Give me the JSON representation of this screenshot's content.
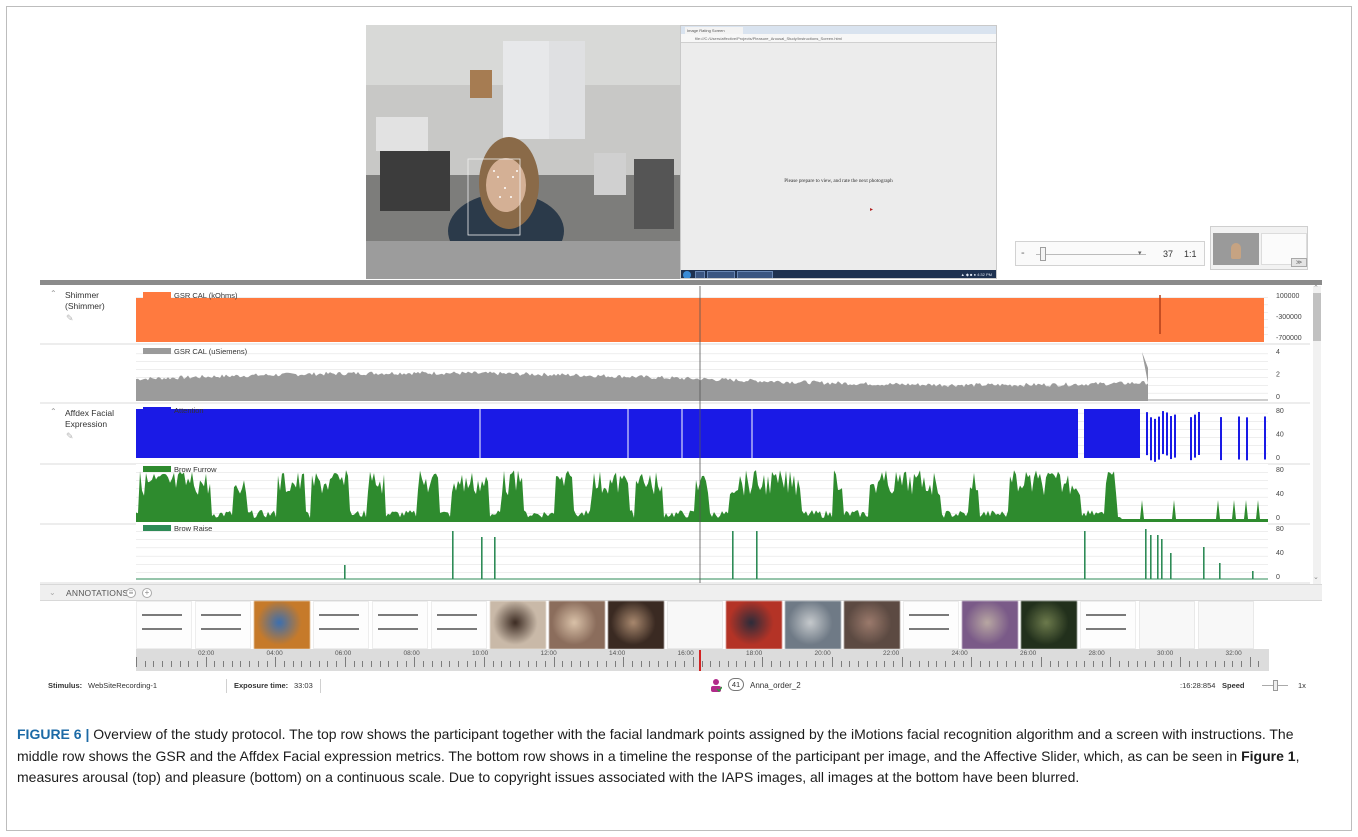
{
  "webcam": {
    "alt": "participant webcam view with facial landmarks"
  },
  "stimulus_screen": {
    "browser_tab": "Image Rating Screen",
    "address": "file:///C:/Users/affective/Projects/Pleasure_Arousal_Study/Instructions_Screen.html",
    "message": "Please prepare to view, and rate the next photograph",
    "tray_text": "▲ ◆ ■ ● 4:32 PM"
  },
  "zoom_control": {
    "minus": "-",
    "arrow": "▾",
    "zoom": "37",
    "ratio": "1:1"
  },
  "miniview": {
    "button": "≫"
  },
  "groups": [
    {
      "label": "Shimmer (Shimmer)"
    },
    {
      "label": "Affdex Facial Expression"
    }
  ],
  "tracks": [
    {
      "label": "GSR CAL (kOhms)",
      "color": "#ff7a3f",
      "ticks": [
        "100000",
        "-300000",
        "-700000"
      ]
    },
    {
      "label": "GSR CAL (uSiemens)",
      "color": "#9a9a9a",
      "ticks": [
        "4",
        "2",
        "0"
      ]
    },
    {
      "label": "Attention",
      "color": "#1a1ae6",
      "ticks": [
        "80",
        "40",
        "0"
      ]
    },
    {
      "label": "Brow Furrow",
      "color": "#2e8b2e",
      "ticks": [
        "80",
        "40",
        "0"
      ]
    },
    {
      "label": "Brow Raise",
      "color": "#2e8b57",
      "ticks": [
        "80",
        "40",
        "0"
      ]
    }
  ],
  "annotations": {
    "label": "ANNOTATIONS",
    "icon_list": "≡",
    "icon_add": "+"
  },
  "timeline": {
    "thumbs": [
      "slider",
      "slider",
      "photo",
      "slider",
      "slider",
      "slider",
      "photo",
      "photo",
      "photo",
      "blank",
      "photo",
      "photo",
      "photo",
      "slider",
      "photo",
      "photo",
      "slider",
      "blank",
      "blank"
    ],
    "ticks": [
      "02:00",
      "04:00",
      "06:00",
      "08:00",
      "10:00",
      "12:00",
      "14:00",
      "16:00",
      "18:00",
      "20:00",
      "22:00",
      "24:00",
      "26:00",
      "28:00",
      "30:00",
      "32:00"
    ]
  },
  "status": {
    "stimulus_label": "Stimulus:",
    "stimulus_value": "WebSiteRecording-1",
    "exposure_label": "Exposure time:",
    "exposure_value": "33:03",
    "count": "41",
    "respondent": "Anna_order_2",
    "time": ":16:28:854",
    "speed_label": "Speed",
    "speed_value": "1x"
  },
  "caption": {
    "label": "FIGURE 6 |",
    "text_1": " Overview of the study protocol. The top row shows the participant together with the facial landmark points assigned by the iMotions facial recognition algorithm and a screen with instructions. The middle row shows the GSR and the Affdex Facial expression metrics. The bottom row shows in a timeline the response of the participant per image, and the Affective Slider, which, as can be seen in ",
    "ref": "Figure 1",
    "text_2": ", measures arousal (top) and pleasure (bottom) on a continuous scale. Due to copyright issues associated with the IAPS images, all images at the bottom have been blurred."
  }
}
